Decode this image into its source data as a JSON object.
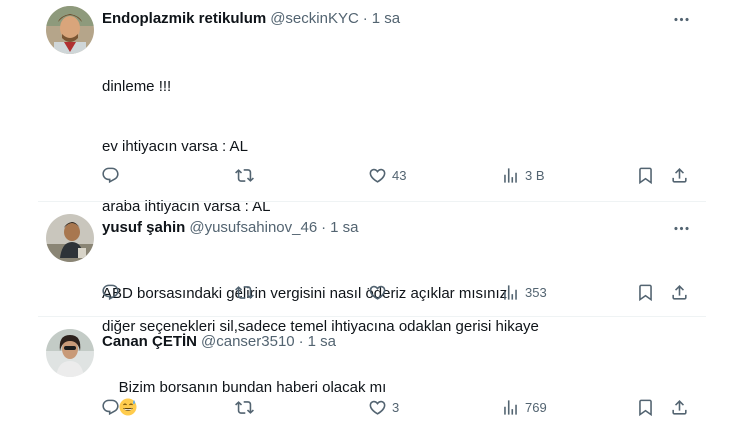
{
  "tweets": [
    {
      "name": "Endoplazmik retikulum",
      "handle": "@seckinKYC",
      "time": "1 sa",
      "lines": [
        "dinleme !!!",
        "ev ihtiyacın varsa : AL",
        "araba ihtiyacın varsa : AL",
        "",
        "diğer seçenekleri sil,sadece temel ihtiyacına odaklan gerisi hikaye"
      ],
      "likes": "43",
      "views": "3 B"
    },
    {
      "name": "yusuf şahin",
      "handle": "@yusufsahinov_46",
      "time": "1 sa",
      "lines": [
        "ABD borsasındaki gelirin vergisini nasıl öderiz açıklar mısınız"
      ],
      "likes": "",
      "views": "353"
    },
    {
      "name": "Canan ÇETİN",
      "handle": "@canser3510",
      "time": "1 sa",
      "text": "Bizim borsanın bundan haberi olacak mı",
      "emoji": "grinning-sweat-emoji",
      "likes": "3",
      "views": "769"
    }
  ],
  "icons": {
    "reply": "reply-icon",
    "repost": "repost-icon",
    "like": "heart-icon",
    "views": "views-icon",
    "bookmark": "bookmark-icon",
    "share": "share-icon",
    "more": "more-icon"
  },
  "colors": {
    "text": "#0f1419",
    "secondary": "#536471",
    "divider": "#eff3f4"
  }
}
